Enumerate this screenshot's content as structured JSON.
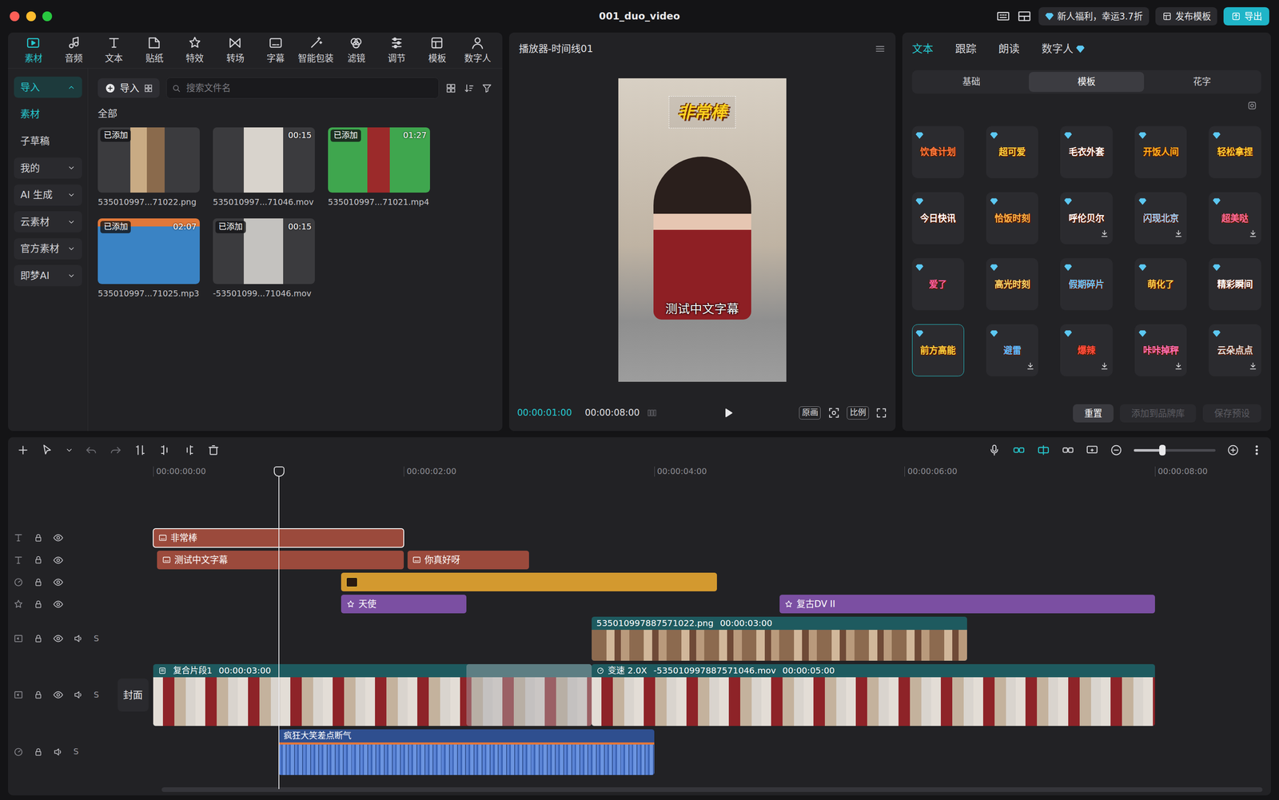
{
  "window": {
    "title": "001_duo_video",
    "promo": "新人福利，幸运3.7折",
    "publish_template": "发布模板",
    "export": "导出"
  },
  "toolbar": {
    "tabs": [
      {
        "label": "素材",
        "selected": true
      },
      {
        "label": "音频",
        "selected": false
      },
      {
        "label": "文本",
        "selected": false
      },
      {
        "label": "贴纸",
        "selected": false
      },
      {
        "label": "特效",
        "selected": false
      },
      {
        "label": "转场",
        "selected": false
      },
      {
        "label": "字幕",
        "selected": false
      },
      {
        "label": "智能包装",
        "selected": false
      },
      {
        "label": "滤镜",
        "selected": false
      },
      {
        "label": "调节",
        "selected": false
      },
      {
        "label": "模板",
        "selected": false
      },
      {
        "label": "数字人",
        "selected": false
      }
    ]
  },
  "sidebar": {
    "items": [
      {
        "label": "导入",
        "kind": "group",
        "selected": true,
        "expanded": true
      },
      {
        "label": "素材",
        "kind": "sub",
        "selected": true
      },
      {
        "label": "子草稿",
        "kind": "sub",
        "selected": false
      },
      {
        "label": "我的",
        "kind": "group",
        "selected": false,
        "expanded": false
      },
      {
        "label": "AI 生成",
        "kind": "group",
        "selected": false,
        "expanded": false
      },
      {
        "label": "云素材",
        "kind": "group",
        "selected": false,
        "expanded": false
      },
      {
        "label": "官方素材",
        "kind": "group",
        "selected": false,
        "expanded": false
      },
      {
        "label": "即梦AI",
        "kind": "group",
        "selected": false,
        "expanded": false
      }
    ]
  },
  "media": {
    "import": "导入",
    "search": {
      "placeholder": "搜索文件名"
    },
    "section": "全部",
    "added_badge": "已添加",
    "items": [
      {
        "name": "535010997...71022.png",
        "kind": "image",
        "added": true
      },
      {
        "name": "535010997...71046.mov",
        "kind": "video",
        "added": false,
        "duration": "00:15"
      },
      {
        "name": "535010997...71021.mp4",
        "kind": "video",
        "added": true,
        "duration": "01:27"
      },
      {
        "name": "535010997...71025.mp3",
        "kind": "audio",
        "added": true,
        "duration": "02:07"
      },
      {
        "name": "-53501099...71046.mov",
        "kind": "video",
        "added": true,
        "duration": "00:15"
      }
    ]
  },
  "player": {
    "title": "播放器-时间线01",
    "current_time": "00:00:01:00",
    "total_time": "00:00:08:00",
    "buttons": [
      "原画",
      "比例"
    ],
    "overlays": {
      "sticker": "非常棒",
      "subtitle": "测试中文字幕"
    }
  },
  "inspector": {
    "tabs": [
      {
        "label": "文本",
        "selected": true,
        "vip": false
      },
      {
        "label": "跟踪",
        "selected": false,
        "vip": false
      },
      {
        "label": "朗读",
        "selected": false,
        "vip": false
      },
      {
        "label": "数字人",
        "selected": false,
        "vip": true
      }
    ],
    "subtabs": [
      {
        "label": "基础",
        "selected": false
      },
      {
        "label": "模板",
        "selected": true
      },
      {
        "label": "花字",
        "selected": false
      }
    ],
    "templates": [
      {
        "label": "饮食计划",
        "vip": true,
        "download": false,
        "selected": false,
        "color": "#ff7a3d"
      },
      {
        "label": "超可爱",
        "vip": true,
        "download": false,
        "selected": false,
        "color": "#ffd23f"
      },
      {
        "label": "毛衣外套",
        "vip": true,
        "download": false,
        "selected": false,
        "color": "#ffffff"
      },
      {
        "label": "开饭人间",
        "vip": true,
        "download": false,
        "selected": false,
        "color": "#ffb020"
      },
      {
        "label": "轻松拿捏",
        "vip": true,
        "download": false,
        "selected": false,
        "color": "#ffcc33"
      },
      {
        "label": "今日快讯",
        "vip": true,
        "download": false,
        "selected": false,
        "color": "#ffffff"
      },
      {
        "label": "恰饭时刻",
        "vip": true,
        "download": false,
        "selected": false,
        "color": "#ffb347"
      },
      {
        "label": "呼伦贝尔",
        "vip": true,
        "download": true,
        "selected": false,
        "color": "#ffffff"
      },
      {
        "label": "闪现北京",
        "vip": true,
        "download": true,
        "selected": false,
        "color": "#9fd3ff"
      },
      {
        "label": "超美哒",
        "vip": true,
        "download": true,
        "selected": false,
        "color": "#ff6b9a"
      },
      {
        "label": "爱了",
        "vip": true,
        "download": false,
        "selected": false,
        "color": "#ff5fa2"
      },
      {
        "label": "高光时刻",
        "vip": true,
        "download": false,
        "selected": false,
        "color": "#ffd86b"
      },
      {
        "label": "假期碎片",
        "vip": true,
        "download": false,
        "selected": false,
        "color": "#6fc8ff"
      },
      {
        "label": "萌化了",
        "vip": true,
        "download": false,
        "selected": false,
        "color": "#ffcf4a"
      },
      {
        "label": "精彩瞬间",
        "vip": true,
        "download": false,
        "selected": false,
        "color": "#ffffff"
      },
      {
        "label": "前方高能",
        "vip": true,
        "download": false,
        "selected": true,
        "color": "#ffd23f"
      },
      {
        "label": "避雷",
        "vip": true,
        "download": true,
        "selected": false,
        "color": "#5ab8ff"
      },
      {
        "label": "爆辣",
        "vip": true,
        "download": true,
        "selected": false,
        "color": "#ff4d3d"
      },
      {
        "label": "咔咔掉秤",
        "vip": true,
        "download": true,
        "selected": false,
        "color": "#ff6fb5"
      },
      {
        "label": "云朵点点",
        "vip": true,
        "download": true,
        "selected": false,
        "color": "#dddddd"
      }
    ],
    "buttons": [
      {
        "label": "重置",
        "disabled": false
      },
      {
        "label": "添加到品牌库",
        "disabled": true
      },
      {
        "label": "保存预设",
        "disabled": true
      }
    ]
  },
  "timeline": {
    "zoom_level": 0.35,
    "playhead": 1.0,
    "cover": "封面",
    "ruler": [
      {
        "label": "00:00:00:00",
        "time": 0
      },
      {
        "label": "00:00:02:00",
        "time": 2
      },
      {
        "label": "00:00:04:00",
        "time": 4
      },
      {
        "label": "00:00:06:00",
        "time": 6
      },
      {
        "label": "00:00:08:00",
        "time": 8
      }
    ],
    "tracks": [
      {
        "kind": "text",
        "locked": false,
        "visible": true,
        "clips": [
          {
            "label": "非常棒",
            "start": 0,
            "duration": 2.0,
            "selected": true
          }
        ]
      },
      {
        "kind": "text",
        "locked": false,
        "visible": true,
        "clips": [
          {
            "label": "测试中文字幕",
            "start": 0.03,
            "duration": 1.97,
            "selected": false
          },
          {
            "label": "你真好呀",
            "start": 2.03,
            "duration": 0.97,
            "selected": false
          }
        ]
      },
      {
        "kind": "sticker",
        "locked": false,
        "visible": true,
        "clips": [
          {
            "start": 1.5,
            "duration": 3.0,
            "selected": false
          }
        ]
      },
      {
        "kind": "effect",
        "locked": false,
        "visible": true,
        "clips": [
          {
            "label": "天使",
            "start": 1.5,
            "duration": 1.0,
            "selected": false
          },
          {
            "label": "复古DV II",
            "start": 5.0,
            "duration": 3.0,
            "selected": false
          }
        ]
      },
      {
        "kind": "video",
        "locked": false,
        "visible": true,
        "muted": false,
        "solo_label": "S",
        "clips": [
          {
            "label": "535010997887571022.png",
            "time": "00:00:03:00",
            "start": 3.5,
            "duration": 3.0,
            "selected": false
          }
        ]
      },
      {
        "kind": "main",
        "locked": false,
        "visible": true,
        "muted": false,
        "solo_label": "S",
        "transition": {
          "start": 2.5,
          "duration": 1.0
        },
        "clips": [
          {
            "label": "复合片段1",
            "time": "00:00:03:00",
            "start": 0,
            "duration": 3.5,
            "selected": false
          },
          {
            "speed": "变速 2.0X",
            "label": "-535010997887571046.mov",
            "time": "00:00:05:00",
            "start": 3.5,
            "duration": 4.5,
            "selected": false
          }
        ]
      },
      {
        "kind": "audio",
        "locked": false,
        "muted": false,
        "solo_label": "S",
        "clips": [
          {
            "label": "疯狂大笑差点断气",
            "start": 1.0,
            "duration": 3.0,
            "selected": false
          }
        ]
      }
    ]
  }
}
